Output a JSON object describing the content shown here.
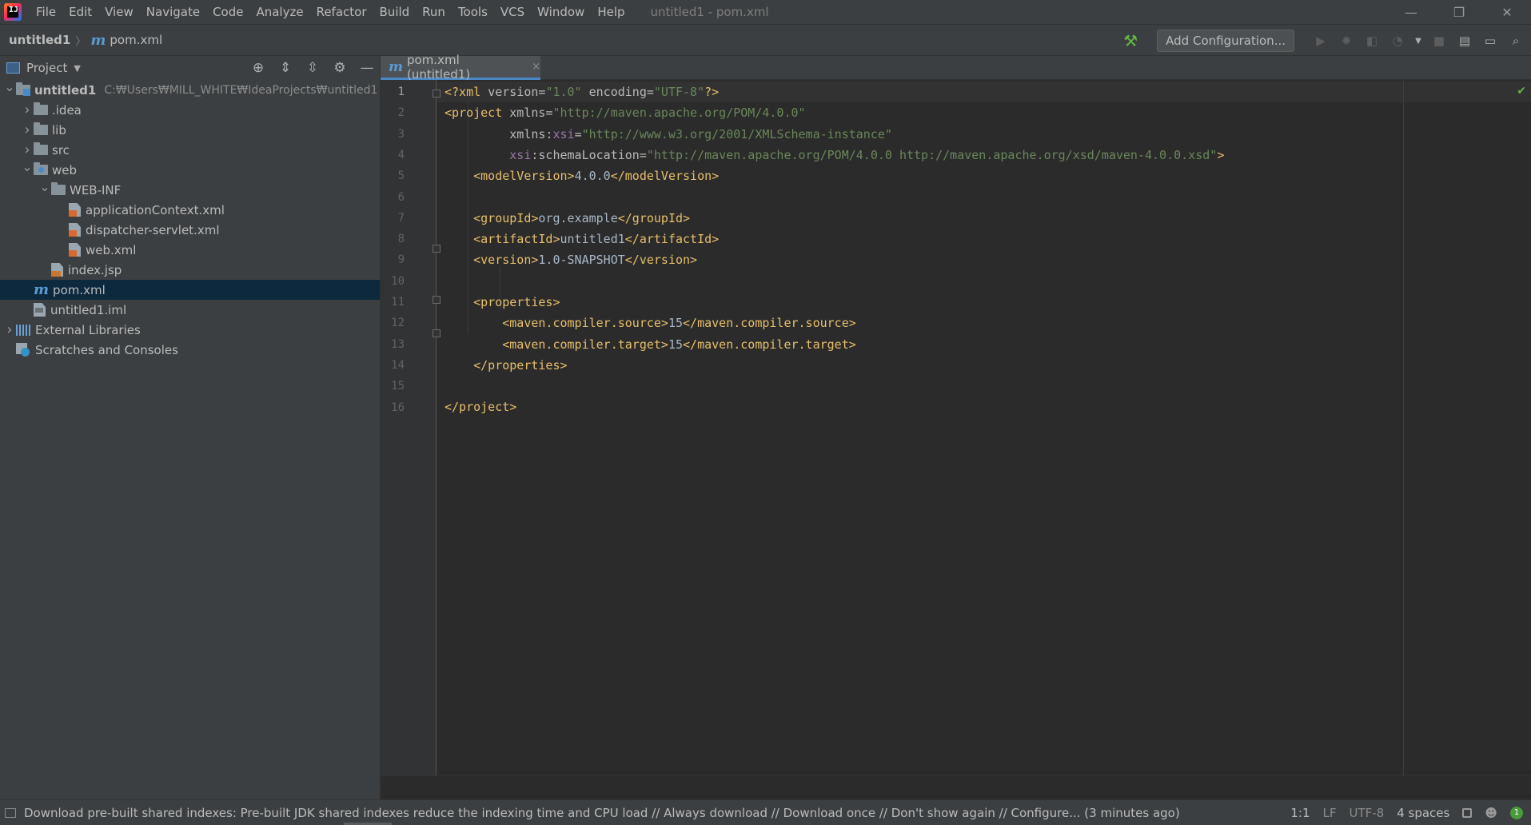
{
  "app": {
    "logo_text": "IJ",
    "window_title": "untitled1 - pom.xml"
  },
  "menu": [
    "File",
    "Edit",
    "View",
    "Navigate",
    "Code",
    "Analyze",
    "Refactor",
    "Build",
    "Run",
    "Tools",
    "VCS",
    "Window",
    "Help"
  ],
  "window_controls": {
    "minimize": "—",
    "restore": "❐",
    "close": "✕"
  },
  "breadcrumb": {
    "project": "untitled1",
    "file": "pom.xml"
  },
  "toolbar": {
    "add_configuration": "Add Configuration..."
  },
  "project_pane": {
    "title": "Project",
    "tree": [
      {
        "label": "untitled1",
        "hint": "C:₩Users₩MILL_WHITE₩IdeaProjects₩untitled1",
        "indent": 0,
        "arrow": "open",
        "icon": "module-folder",
        "bold": true
      },
      {
        "label": ".idea",
        "indent": 1,
        "arrow": "closed",
        "icon": "folder"
      },
      {
        "label": "lib",
        "indent": 1,
        "arrow": "closed",
        "icon": "folder"
      },
      {
        "label": "src",
        "indent": 1,
        "arrow": "closed",
        "icon": "folder"
      },
      {
        "label": "web",
        "indent": 1,
        "arrow": "open",
        "icon": "web-folder"
      },
      {
        "label": "WEB-INF",
        "indent": 2,
        "arrow": "open",
        "icon": "folder"
      },
      {
        "label": "applicationContext.xml",
        "indent": 3,
        "arrow": "none",
        "icon": "spring-xml"
      },
      {
        "label": "dispatcher-servlet.xml",
        "indent": 3,
        "arrow": "none",
        "icon": "spring-xml"
      },
      {
        "label": "web.xml",
        "indent": 3,
        "arrow": "none",
        "icon": "web-xml"
      },
      {
        "label": "index.jsp",
        "indent": 2,
        "arrow": "none",
        "icon": "jsp"
      },
      {
        "label": "pom.xml",
        "indent": 1,
        "arrow": "none",
        "icon": "maven",
        "selected": true
      },
      {
        "label": "untitled1.iml",
        "indent": 1,
        "arrow": "none",
        "icon": "iml"
      },
      {
        "label": "External Libraries",
        "indent": 0,
        "arrow": "closed",
        "icon": "libraries"
      },
      {
        "label": "Scratches and Consoles",
        "indent": 0,
        "arrow": "none",
        "icon": "scratches"
      }
    ]
  },
  "editor": {
    "tab_label": "pom.xml (untitled1)",
    "tab_close": "×",
    "line_numbers": [
      "1",
      "2",
      "3",
      "4",
      "5",
      "6",
      "7",
      "8",
      "9",
      "10",
      "11",
      "12",
      "13",
      "14",
      "15",
      "16"
    ],
    "code_text": {
      "l1_decl_open": "<?xml ",
      "l1_attr_version": "version",
      "l1_eq1": "=",
      "l1_val_version": "\"1.0\"",
      "l1_attr_encoding": " encoding",
      "l1_eq2": "=",
      "l1_val_encoding": "\"UTF-8\"",
      "l1_decl_close": "?>",
      "l2_tag": "<project ",
      "l2_attr": "xmlns",
      "l2_eq": "=",
      "l2_val": "\"http://maven.apache.org/POM/4.0.0\"",
      "l3_attr": "xmlns:",
      "l3_ns": "xsi",
      "l3_eq": "=",
      "l3_val": "\"http://www.w3.org/2001/XMLSchema-instance\"",
      "l4_ns": "xsi",
      "l4_attr": ":schemaLocation",
      "l4_eq": "=",
      "l4_val": "\"http://maven.apache.org/POM/4.0.0 http://maven.apache.org/xsd/maven-4.0.0.xsd\"",
      "l4_close": ">",
      "l5_open": "<modelVersion>",
      "l5_text": "4.0.0",
      "l5_close": "</modelVersion>",
      "l7_open": "<groupId>",
      "l7_text": "org.example",
      "l7_close": "</groupId>",
      "l8_open": "<artifactId>",
      "l8_text": "untitled1",
      "l8_close": "</artifactId>",
      "l9_open": "<version>",
      "l9_text": "1.0-SNAPSHOT",
      "l9_close": "</version>",
      "l11": "<properties>",
      "l12_open": "<maven.compiler.source>",
      "l12_text": "15",
      "l12_close": "</maven.compiler.source>",
      "l13_open": "<maven.compiler.target>",
      "l13_text": "15",
      "l13_close": "</maven.compiler.target>",
      "l14": "</properties>",
      "l16": "</project>"
    }
  },
  "status_bar": {
    "message": "Download pre-built shared indexes: Pre-built JDK shared indexes reduce the indexing time and CPU load // Always download // Download once // Don't show again // Configure... (3 minutes ago)",
    "position": "1:1",
    "line_separator": "LF",
    "encoding": "UTF-8",
    "indent": "4 spaces",
    "notifications_count": "1"
  }
}
